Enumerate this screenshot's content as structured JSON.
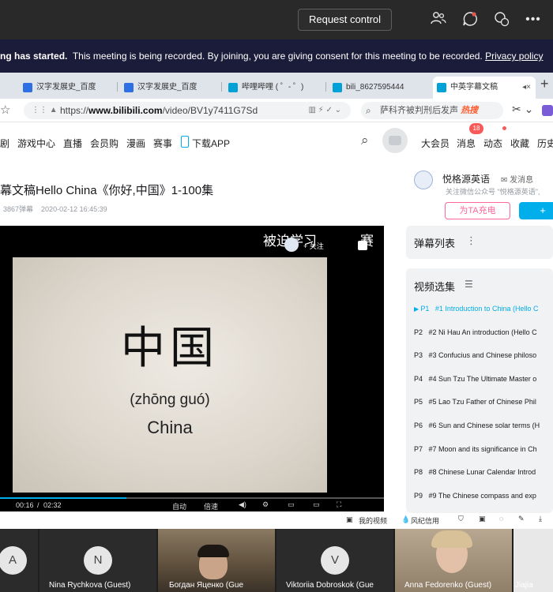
{
  "teams": {
    "request_control": "Request control",
    "banner_bold": "ng has started.",
    "banner_text": "This meeting is being recorded. By joining, you are giving consent for this meeting to be recorded.",
    "banner_link": "Privacy policy"
  },
  "browser": {
    "tabs": [
      {
        "label": "汉字发展史_百度",
        "color": "#2f6fe4"
      },
      {
        "label": "汉字发展史_百度",
        "color": "#2f6fe4"
      },
      {
        "label": "哔哩哔哩 ( ゜- ゜)",
        "color": "#00a1d6"
      },
      {
        "label": "bili_8627595444",
        "color": "#00a1d6"
      },
      {
        "label": "中英字幕文稿",
        "color": "#00a1d6"
      }
    ],
    "url_prefix": "https://",
    "url_domain": "www.bilibili.com",
    "url_path": "/video/BV1y7411G7Sd",
    "search_text": "萨科齐被判刑后发声",
    "search_hot": "热搜"
  },
  "site": {
    "nav_left": [
      "剧",
      "游戏中心",
      "直播",
      "会员购",
      "漫画",
      "赛事",
      "下载APP"
    ],
    "nav_right": [
      "大会员",
      "消息",
      "动态",
      "收藏",
      "历史"
    ],
    "msg_badge": "18"
  },
  "video": {
    "title": "幕文稿Hello China《你好,中国》1-100集",
    "danmaku_count": "3867弹幕",
    "date": "2020-02-12 16:45:39",
    "uploader_name": "悦格源英语",
    "send_msg": "发消息",
    "uploader_desc": "关注微信公众号 \"悦格源英语\",",
    "charge_button": "为TA充电",
    "follow_button": "+",
    "hanzi": "中国",
    "pinyin": "(zhōng guó)",
    "english": "China",
    "danmaku_1": "被迫学习",
    "danmaku_2": "赛",
    "follow_tag": "+ 关注",
    "time_current": "00:16",
    "time_total": "02:32",
    "ctrl_1": "自动",
    "ctrl_2": "倍速",
    "progress": 0.33
  },
  "panel": {
    "danmaku_list": "弹幕列表",
    "episode_header": "视频选集",
    "episodes": [
      {
        "num": "P1",
        "title": "#1 Introduction to China (Hello C"
      },
      {
        "num": "P2",
        "title": "#2 Ni Hau An introduction (Hello C"
      },
      {
        "num": "P3",
        "title": "#3 Confucius and Chinese philoso"
      },
      {
        "num": "P4",
        "title": "#4 Sun Tzu The Ultimate Master o"
      },
      {
        "num": "P5",
        "title": "#5 Lao Tzu Father of Chinese Phil"
      },
      {
        "num": "P6",
        "title": "#6 Sun and Chinese solar terms (H"
      },
      {
        "num": "P7",
        "title": "#7 Moon and its significance in Ch"
      },
      {
        "num": "P8",
        "title": "#8 Chinese Lunar Calendar Introd"
      },
      {
        "num": "P9",
        "title": "#9 The Chinese compass and exp"
      }
    ],
    "footer_my_video": "我的视频",
    "footer_credit": "风纪信用"
  },
  "participants": [
    {
      "initial": "A",
      "name": ""
    },
    {
      "initial": "N",
      "name": "Nina Rychkova (Guest)"
    },
    {
      "initial": "",
      "name": "Богдан Яценко (Gue"
    },
    {
      "initial": "V",
      "name": "Viktoriia Dobroskok (Gue"
    },
    {
      "initial": "",
      "name": "Anna Fedorenko (Guest)"
    },
    {
      "initial": "",
      "name": "Jiajia"
    }
  ]
}
